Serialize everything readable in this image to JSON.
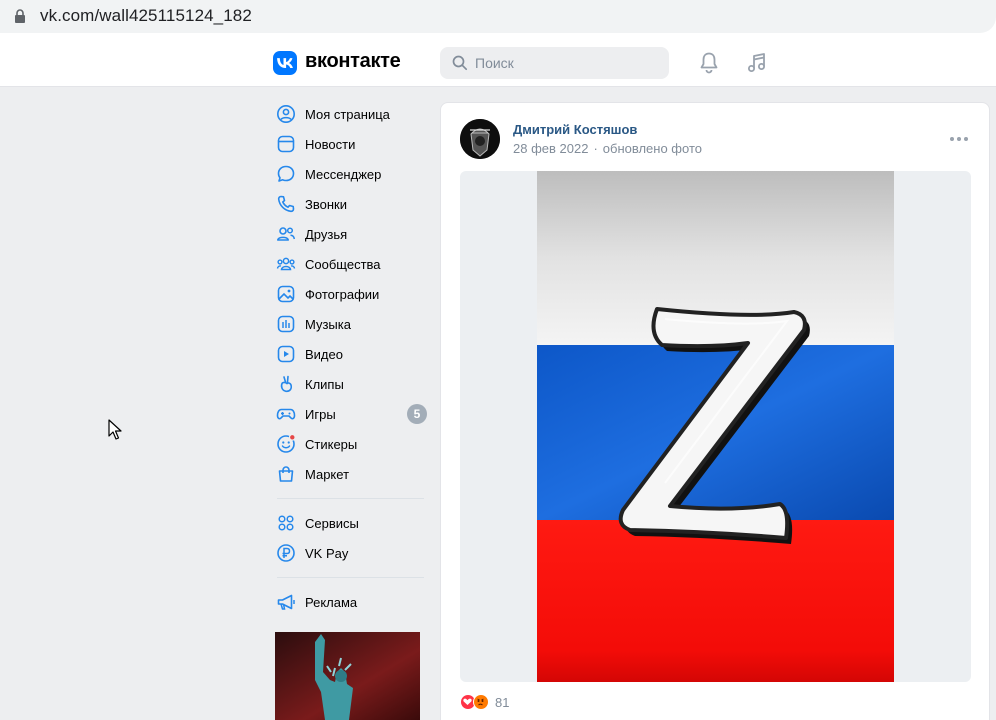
{
  "browser": {
    "url": "vk.com/wall425115124_182"
  },
  "header": {
    "logo_text": "вконтакте",
    "search_placeholder": "Поиск",
    "icons": [
      "bell-icon",
      "music-note-icon"
    ]
  },
  "nav": {
    "items": [
      {
        "label": "Моя страница",
        "icon": "user-circle-icon"
      },
      {
        "label": "Новости",
        "icon": "newsfeed-icon"
      },
      {
        "label": "Мессенджер",
        "icon": "message-bubble-icon"
      },
      {
        "label": "Звонки",
        "icon": "phone-icon"
      },
      {
        "label": "Друзья",
        "icon": "friends-icon"
      },
      {
        "label": "Сообщества",
        "icon": "communities-icon"
      },
      {
        "label": "Фотографии",
        "icon": "picture-icon"
      },
      {
        "label": "Музыка",
        "icon": "music-icon"
      },
      {
        "label": "Видео",
        "icon": "video-icon"
      },
      {
        "label": "Клипы",
        "icon": "clips-icon"
      },
      {
        "label": "Игры",
        "icon": "gamepad-icon",
        "badge": "5"
      },
      {
        "label": "Стикеры",
        "icon": "sticker-icon"
      },
      {
        "label": "Маркет",
        "icon": "shopping-bag-icon"
      }
    ],
    "secondary": [
      {
        "label": "Сервисы",
        "icon": "services-grid-icon"
      },
      {
        "label": "VK Pay",
        "icon": "ruble-icon"
      }
    ],
    "tertiary": [
      {
        "label": "Реклама",
        "icon": "megaphone-icon"
      }
    ]
  },
  "post": {
    "author": "Дмитрий Костяшов",
    "date": "28 фев 2022",
    "separator": "·",
    "action": "обновлено фото",
    "reactions_count": "81",
    "reaction_icons": [
      "heart-reaction-icon",
      "angry-reaction-icon"
    ]
  },
  "colors": {
    "vk_blue": "#0077ff",
    "link": "#2a5885",
    "muted": "#818c99",
    "page_bg": "#edeef0",
    "badge": "#a3adb8"
  }
}
